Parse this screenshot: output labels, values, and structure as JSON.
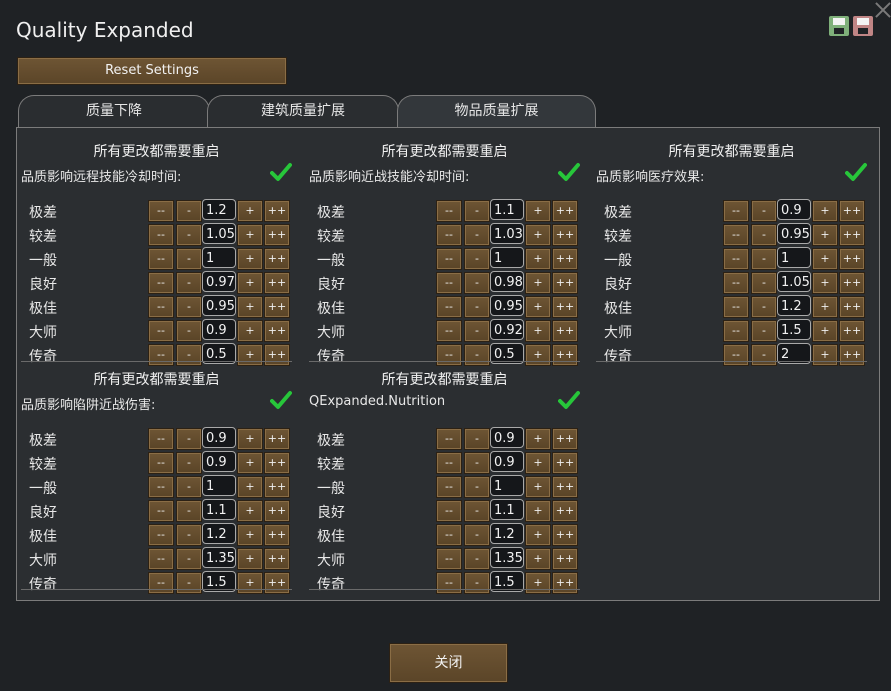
{
  "window": {
    "title": "Quality Expanded"
  },
  "icons": {
    "close": "close-x-icon",
    "save": "save-disk-icon",
    "load": "load-disk-icon",
    "check": "checkmark-icon"
  },
  "colors": {
    "button": "#6e5534",
    "check": "#27c63a",
    "background": "#1f2225"
  },
  "toolbar": {
    "reset_label": "Reset Settings"
  },
  "tabs": [
    {
      "label": "质量下降",
      "active": false
    },
    {
      "label": "建筑质量扩展",
      "active": false
    },
    {
      "label": "物品质量扩展",
      "active": true
    }
  ],
  "buttons": {
    "dec_big": "--",
    "dec": "-",
    "inc": "+",
    "inc_big": "++"
  },
  "blocks": [
    {
      "header": "所有更改都需要重启",
      "setting": "品质影响远程技能冷却时间:",
      "rows": [
        {
          "label": "极差",
          "value": "1.2"
        },
        {
          "label": "较差",
          "value": "1.05"
        },
        {
          "label": "一般",
          "value": "1"
        },
        {
          "label": "良好",
          "value": "0.97"
        },
        {
          "label": "极佳",
          "value": "0.95"
        },
        {
          "label": "大师",
          "value": "0.9"
        },
        {
          "label": "传奇",
          "value": "0.5"
        }
      ]
    },
    {
      "header": "所有更改都需要重启",
      "setting": "品质影响近战技能冷却时间:",
      "rows": [
        {
          "label": "极差",
          "value": "1.1"
        },
        {
          "label": "较差",
          "value": "1.03"
        },
        {
          "label": "一般",
          "value": "1"
        },
        {
          "label": "良好",
          "value": "0.98"
        },
        {
          "label": "极佳",
          "value": "0.95"
        },
        {
          "label": "大师",
          "value": "0.92"
        },
        {
          "label": "传奇",
          "value": "0.5"
        }
      ]
    },
    {
      "header": "所有更改都需要重启",
      "setting": "品质影响医疗效果:",
      "rows": [
        {
          "label": "极差",
          "value": "0.9"
        },
        {
          "label": "较差",
          "value": "0.95"
        },
        {
          "label": "一般",
          "value": "1"
        },
        {
          "label": "良好",
          "value": "1.05"
        },
        {
          "label": "极佳",
          "value": "1.2"
        },
        {
          "label": "大师",
          "value": "1.5"
        },
        {
          "label": "传奇",
          "value": "2"
        }
      ]
    },
    {
      "header": "所有更改都需要重启",
      "setting": "品质影响陷阱近战伤害:",
      "rows": [
        {
          "label": "极差",
          "value": "0.9"
        },
        {
          "label": "较差",
          "value": "0.9"
        },
        {
          "label": "一般",
          "value": "1"
        },
        {
          "label": "良好",
          "value": "1.1"
        },
        {
          "label": "极佳",
          "value": "1.2"
        },
        {
          "label": "大师",
          "value": "1.35"
        },
        {
          "label": "传奇",
          "value": "1.5"
        }
      ]
    },
    {
      "header": "所有更改都需要重启",
      "setting": "QExpanded.Nutrition",
      "rows": [
        {
          "label": "极差",
          "value": "0.9"
        },
        {
          "label": "较差",
          "value": "0.9"
        },
        {
          "label": "一般",
          "value": "1"
        },
        {
          "label": "良好",
          "value": "1.1"
        },
        {
          "label": "极佳",
          "value": "1.2"
        },
        {
          "label": "大师",
          "value": "1.35"
        },
        {
          "label": "传奇",
          "value": "1.5"
        }
      ]
    }
  ],
  "footer": {
    "close_label": "关闭"
  }
}
